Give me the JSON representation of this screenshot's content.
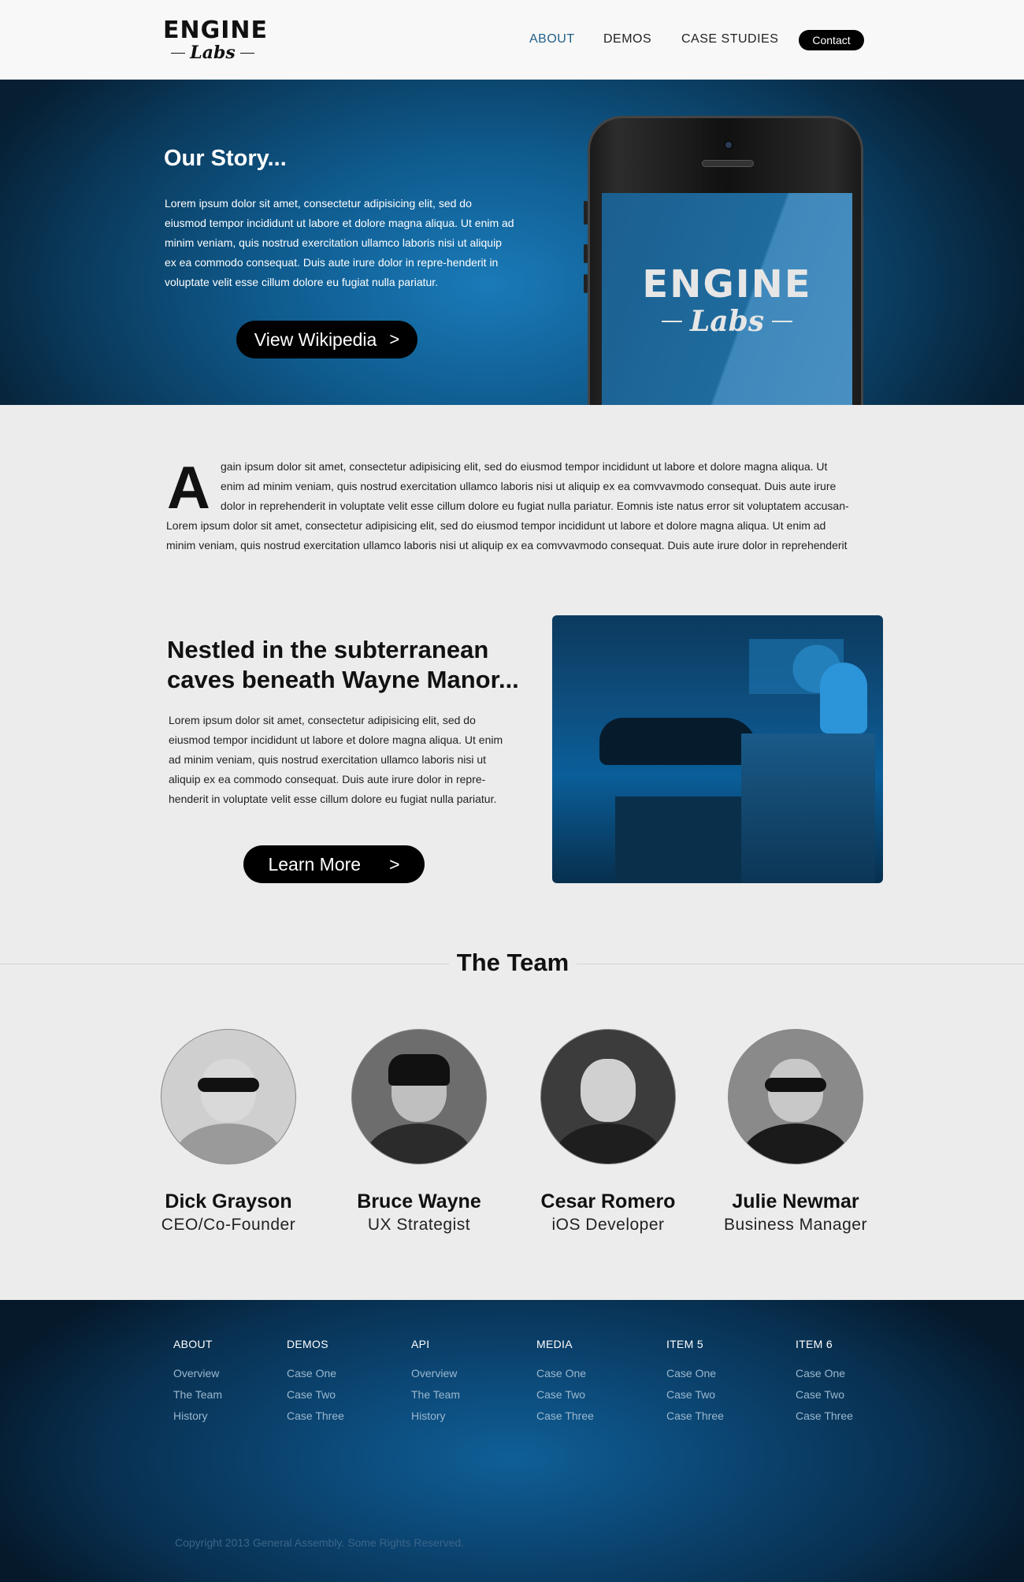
{
  "header": {
    "logo_top": "ENGINE",
    "logo_bottom": "Labs",
    "nav": [
      {
        "label": "ABOUT",
        "active": true
      },
      {
        "label": "DEMOS",
        "active": false
      },
      {
        "label": "CASE STUDIES",
        "active": false
      }
    ],
    "contact_label": "Contact"
  },
  "hero": {
    "title": "Our Story...",
    "text": "Lorem ipsum dolor sit amet, consectetur adipisicing elit, sed do eiusmod tempor incididunt ut labore et dolore magna aliqua. Ut enim ad minim veniam, quis nostrud exercitation ullamco laboris nisi ut aliquip ex ea commodo consequat. Duis aute irure dolor in repre-henderit in voluptate velit esse cillum dolore eu fugiat nulla pariatur.",
    "button_label": "View Wikipedia",
    "button_icon": "chevron-right-icon",
    "phone_logo_top": "ENGINE",
    "phone_logo_bottom": "Labs"
  },
  "intro": {
    "dropcap": "A",
    "lines": [
      "gain ipsum dolor sit amet, consectetur adipisicing elit, sed do eiusmod tempor incididunt ut labore et dolore magna aliqua. Ut",
      "enim ad minim veniam, quis nostrud exercitation ullamco laboris nisi ut aliquip ex ea comvvavmodo consequat. Duis aute irure",
      "dolor in reprehenderit in voluptate velit esse cillum dolore eu fugiat nulla pariatur. Eomnis iste natus error sit voluptatem accusan-",
      "Lorem ipsum dolor sit amet, consectetur adipisicing elit, sed do eiusmod tempor incididunt ut labore et dolore magna aliqua. Ut enim ad",
      "minim veniam, quis nostrud exercitation ullamco laboris nisi ut aliquip ex ea comvvavmodo consequat. Duis aute irure dolor in reprehenderit"
    ]
  },
  "feature": {
    "title": "Nestled in the subterranean caves beneath Wayne Manor...",
    "text": "Lorem ipsum dolor sit amet, consectetur adipisicing elit, sed do eiusmod tempor incididunt ut labore et dolore magna aliqua. Ut enim ad minim veniam, quis nostrud exercitation ullamco laboris nisi ut aliquip ex ea commodo consequat. Duis aute irure dolor in repre-henderit in voluptate velit esse cillum dolore eu fugiat nulla pariatur.",
    "button_label": "Learn More",
    "button_icon": "chevron-right-icon"
  },
  "team": {
    "title": "The Team",
    "members": [
      {
        "name": "Dick Grayson",
        "role": "CEO/Co-Founder"
      },
      {
        "name": "Bruce Wayne",
        "role": "UX Strategist"
      },
      {
        "name": "Cesar Romero",
        "role": "iOS Developer"
      },
      {
        "name": "Julie Newmar",
        "role": "Business Manager"
      }
    ]
  },
  "footer": {
    "columns": [
      {
        "heading": "ABOUT",
        "links": [
          "Overview",
          "The Team",
          "History"
        ]
      },
      {
        "heading": "DEMOS",
        "links": [
          "Case One",
          "Case Two",
          "Case Three"
        ]
      },
      {
        "heading": "API",
        "links": [
          "Overview",
          "The Team",
          "History"
        ]
      },
      {
        "heading": "MEDIA",
        "links": [
          "Case One",
          "Case Two",
          "Case Three"
        ]
      },
      {
        "heading": "ITEM 5",
        "links": [
          "Case One",
          "Case Two",
          "Case Three"
        ]
      },
      {
        "heading": "ITEM 6",
        "links": [
          "Case One",
          "Case Two",
          "Case Three"
        ]
      }
    ],
    "copyright": "Copyright 2013 General Assembly. Some Rights Reserved."
  },
  "colors": {
    "accent_nav": "#1f5e86",
    "hero_blue": "#0f5b8e",
    "button_bg": "#000000",
    "page_bg": "#ececec"
  }
}
